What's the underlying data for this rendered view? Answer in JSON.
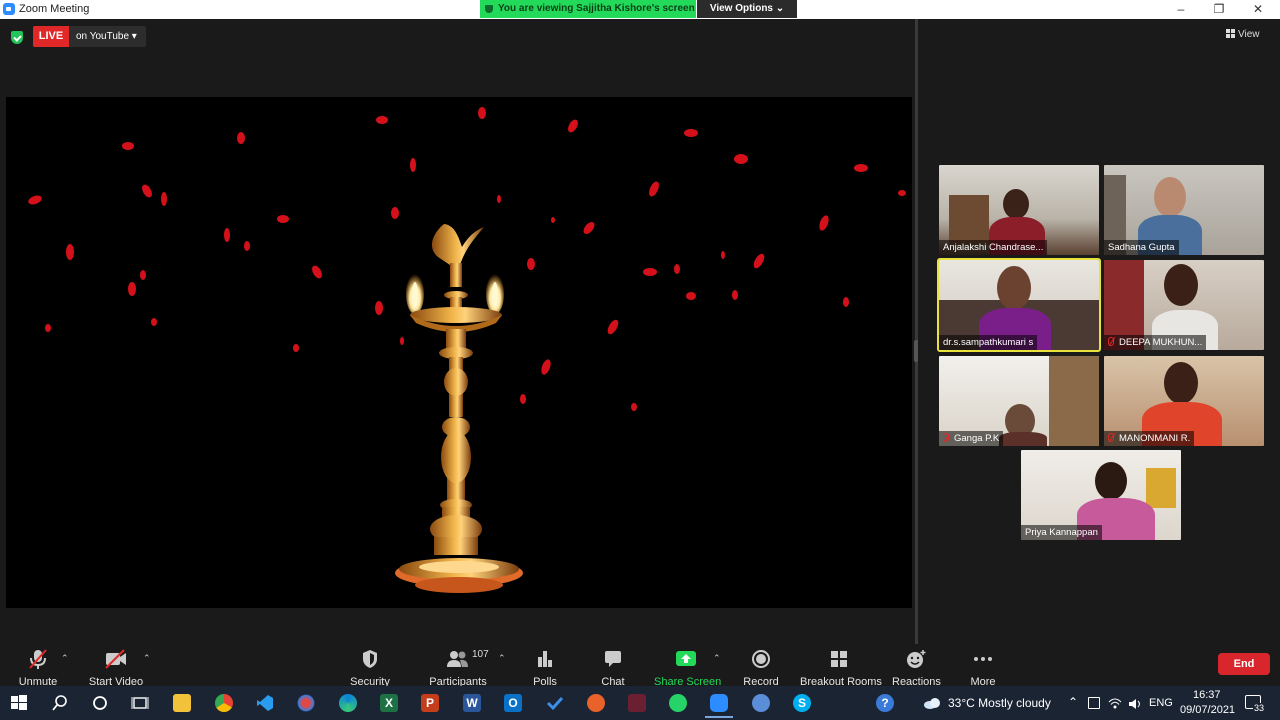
{
  "window": {
    "title": "Zoom Meeting"
  },
  "banner": {
    "viewing_text": "You are viewing Sajjitha Kishore's screen",
    "view_options": "View Options ⌄"
  },
  "stream": {
    "live_label": "LIVE",
    "destination": "on YouTube ▾"
  },
  "view_button": {
    "label": "View"
  },
  "participants": [
    {
      "name": "Anjalakshi Chandrase...",
      "muted": false,
      "active": false
    },
    {
      "name": "Sadhana Gupta",
      "muted": false,
      "active": false
    },
    {
      "name": "dr.s.sampathkumari s",
      "muted": false,
      "active": true
    },
    {
      "name": "DEEPA MUKHUN...",
      "muted": true,
      "active": false
    },
    {
      "name": "Ganga P.K",
      "muted": true,
      "active": false
    },
    {
      "name": "MANONMANI R.",
      "muted": true,
      "active": false
    },
    {
      "name": "Priya Kannappan",
      "muted": false,
      "active": false
    }
  ],
  "toolbar": {
    "unmute": "Unmute",
    "start_video": "Start Video",
    "security": "Security",
    "participants": "Participants",
    "participant_count": "107",
    "polls": "Polls",
    "chat": "Chat",
    "share_screen": "Share Screen",
    "record": "Record",
    "breakout_rooms": "Breakout Rooms",
    "reactions": "Reactions",
    "more": "More",
    "end": "End"
  },
  "taskbar": {
    "weather": "33°C  Mostly cloudy",
    "language": "ENG",
    "time": "16:37",
    "date": "09/07/2021",
    "notifications": "33"
  },
  "colors": {
    "accent_green": "#23d959",
    "live_red": "#e02828",
    "end_red": "#d9262c",
    "active_speaker": "#e8e23a"
  }
}
